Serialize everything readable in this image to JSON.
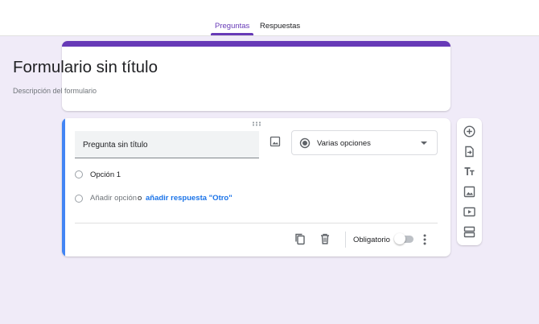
{
  "tabs": [
    {
      "label": "Preguntas",
      "active": true
    },
    {
      "label": "Respuestas",
      "active": false
    }
  ],
  "form": {
    "title": "Formulario sin título",
    "description_placeholder": "Descripción del formulario"
  },
  "question": {
    "title": "Pregunta sin título",
    "type": "Varias opciones",
    "options": [
      {
        "label": "Opción 1"
      }
    ],
    "add_option": "Añadir opción",
    "or": "o",
    "add_other": "añadir respuesta \"Otro\"",
    "required_label": "Obligatorio",
    "required": false
  },
  "toolbar": {
    "icons": [
      "add-question-icon",
      "import-questions-icon",
      "add-title-icon",
      "add-image-icon",
      "add-video-icon",
      "add-section-icon"
    ]
  },
  "colors": {
    "theme": "#673ab7",
    "background": "#f0ebf8",
    "active_card_bar": "#4285f4",
    "link": "#1a73e8"
  }
}
